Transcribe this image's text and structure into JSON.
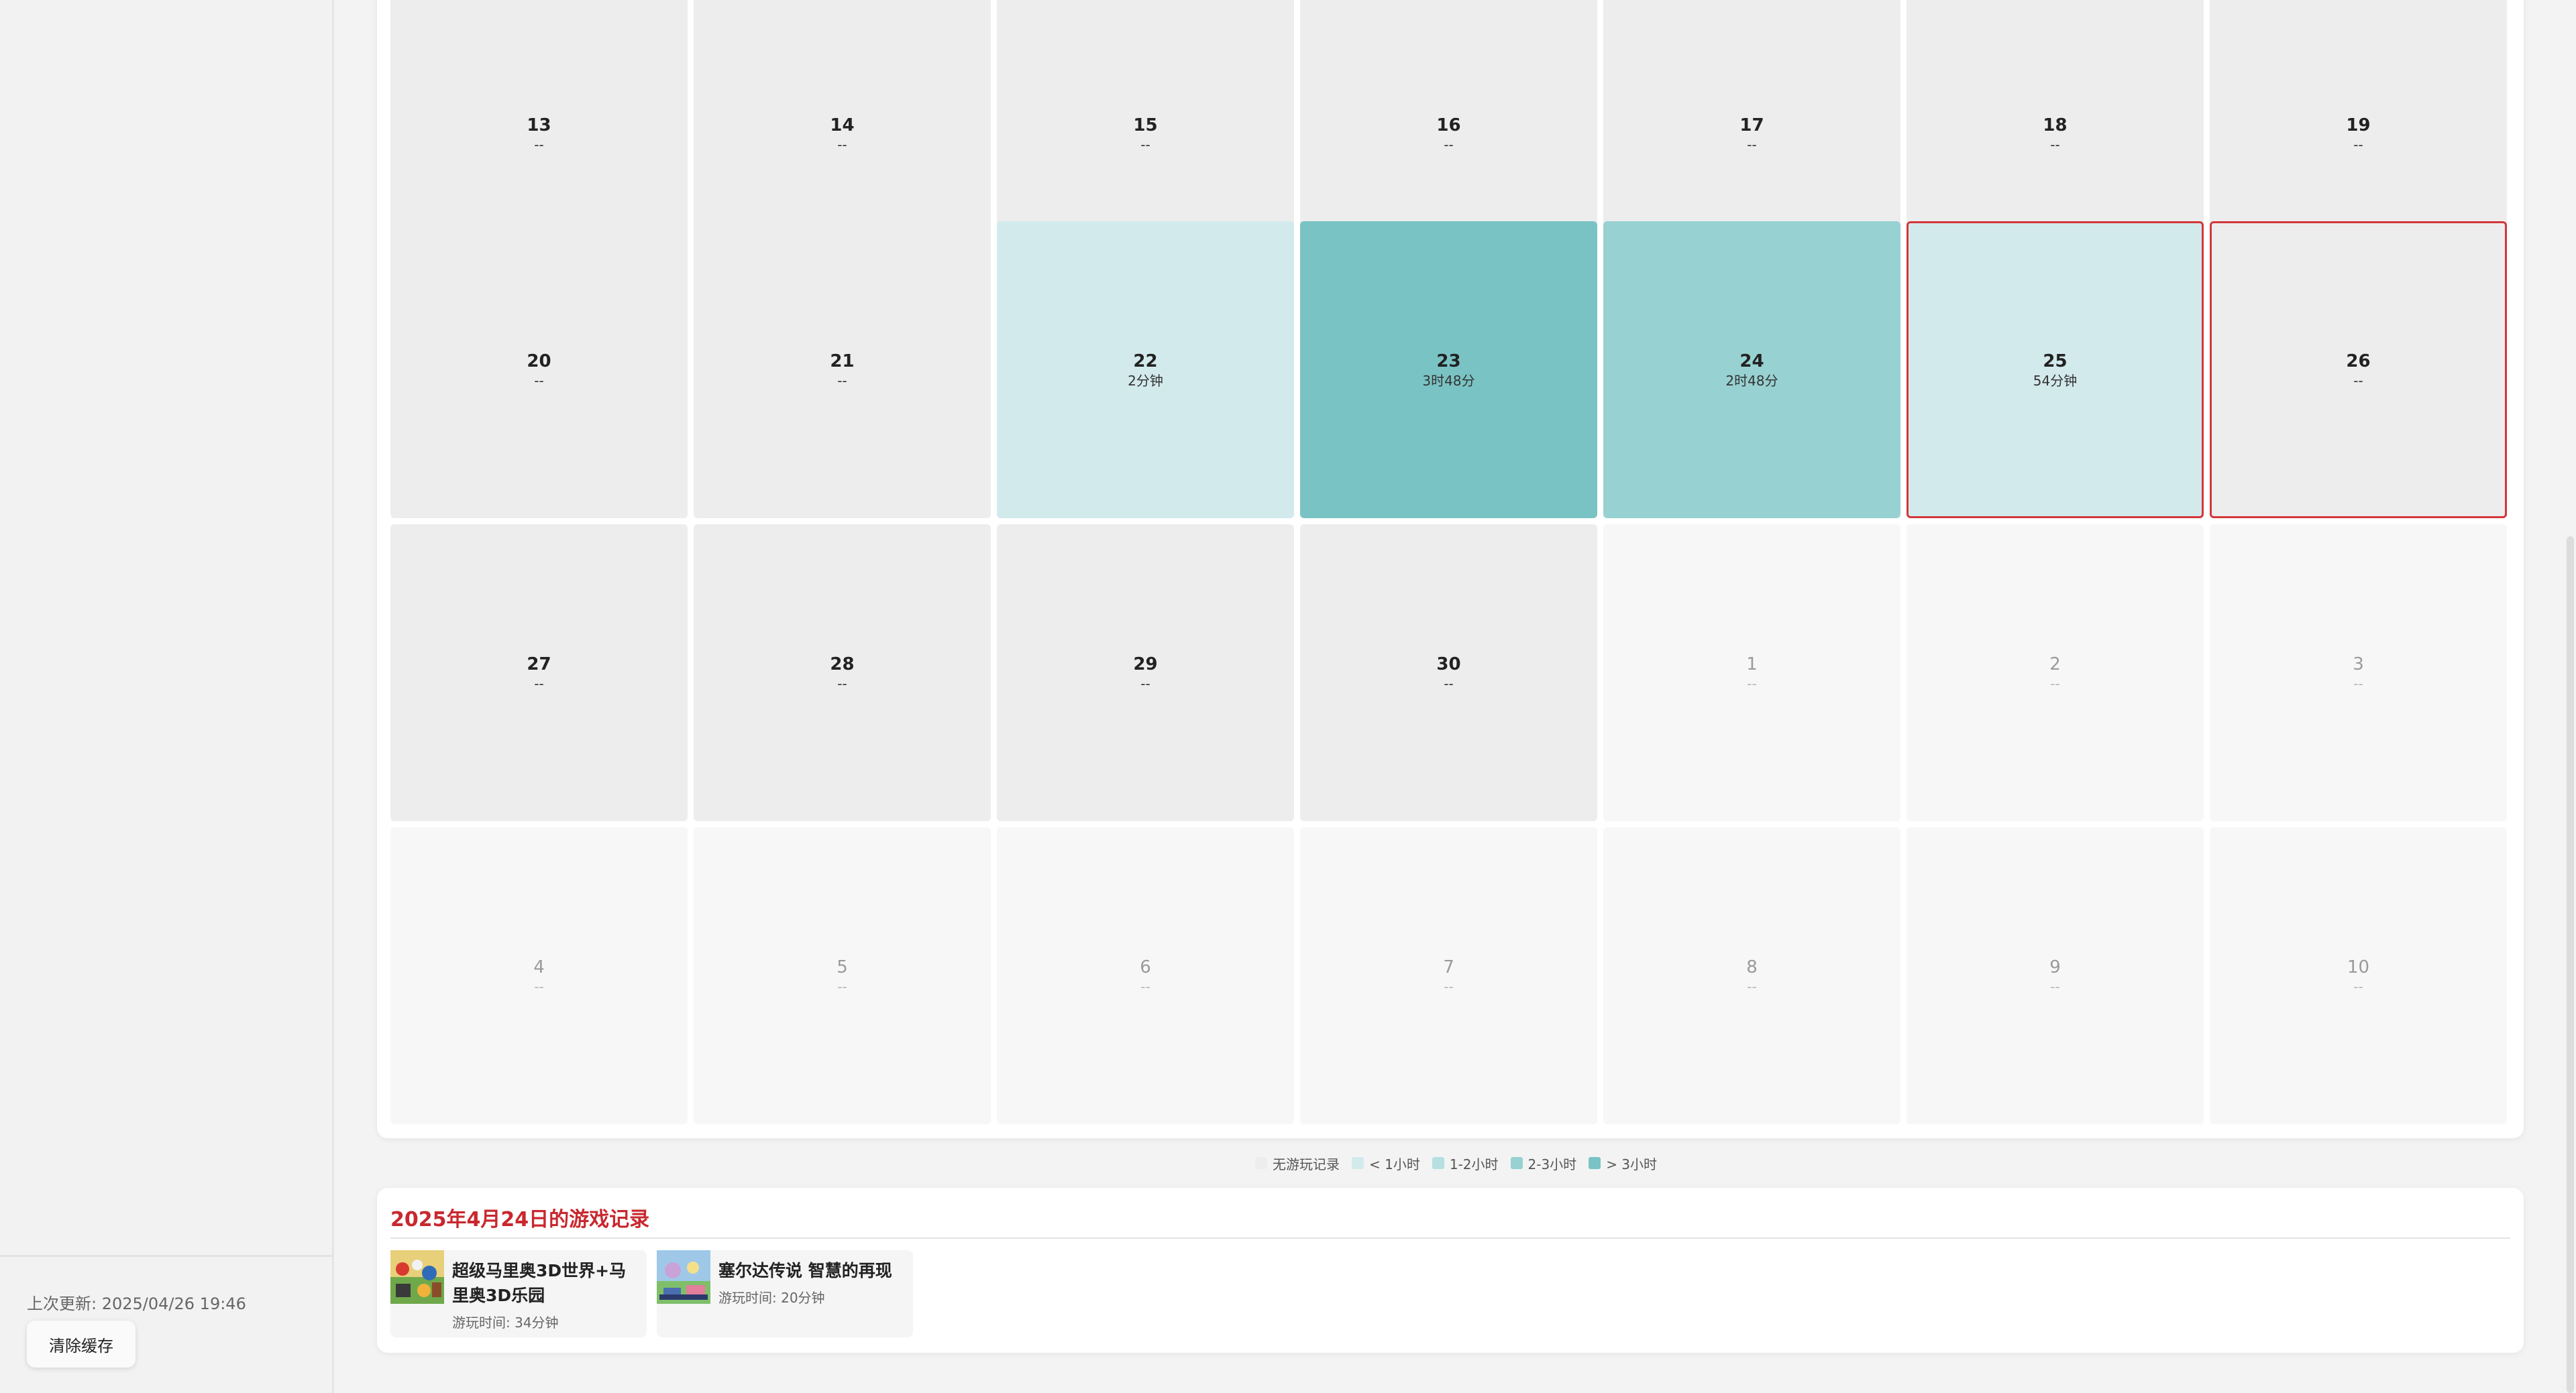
{
  "sidebar": {
    "last_updated": "上次更新: 2025/04/26 19:46",
    "clear_cache_label": "清除缓存"
  },
  "calendar": {
    "rows": [
      [
        {
          "day": "13",
          "time": "--",
          "level": "none",
          "current_month": true,
          "today": false
        },
        {
          "day": "14",
          "time": "--",
          "level": "none",
          "current_month": true,
          "today": false
        },
        {
          "day": "15",
          "time": "--",
          "level": "none",
          "current_month": true,
          "today": false
        },
        {
          "day": "16",
          "time": "--",
          "level": "none",
          "current_month": true,
          "today": false
        },
        {
          "day": "17",
          "time": "--",
          "level": "none",
          "current_month": true,
          "today": false
        },
        {
          "day": "18",
          "time": "--",
          "level": "none",
          "current_month": true,
          "today": false
        },
        {
          "day": "19",
          "time": "--",
          "level": "none",
          "current_month": true,
          "today": false
        }
      ],
      [
        {
          "day": "20",
          "time": "--",
          "level": "none",
          "current_month": true,
          "today": false
        },
        {
          "day": "21",
          "time": "--",
          "level": "none",
          "current_month": true,
          "today": false
        },
        {
          "day": "22",
          "time": "2分钟",
          "level": "lt1",
          "current_month": true,
          "today": false
        },
        {
          "day": "23",
          "time": "3时48分",
          "level": "gt3",
          "current_month": true,
          "today": false
        },
        {
          "day": "24",
          "time": "2时48分",
          "level": "2to3",
          "current_month": true,
          "today": false
        },
        {
          "day": "25",
          "time": "54分钟",
          "level": "lt1",
          "current_month": true,
          "today": true
        },
        {
          "day": "26",
          "time": "--",
          "level": "none",
          "current_month": true,
          "today": true
        }
      ],
      [
        {
          "day": "27",
          "time": "--",
          "level": "none",
          "current_month": true,
          "today": false
        },
        {
          "day": "28",
          "time": "--",
          "level": "none",
          "current_month": true,
          "today": false
        },
        {
          "day": "29",
          "time": "--",
          "level": "none",
          "current_month": true,
          "today": false
        },
        {
          "day": "30",
          "time": "--",
          "level": "none",
          "current_month": true,
          "today": false
        },
        {
          "day": "1",
          "time": "--",
          "level": "none",
          "current_month": false,
          "today": false
        },
        {
          "day": "2",
          "time": "--",
          "level": "none",
          "current_month": false,
          "today": false
        },
        {
          "day": "3",
          "time": "--",
          "level": "none",
          "current_month": false,
          "today": false
        }
      ],
      [
        {
          "day": "4",
          "time": "--",
          "level": "none",
          "current_month": false,
          "today": false
        },
        {
          "day": "5",
          "time": "--",
          "level": "none",
          "current_month": false,
          "today": false
        },
        {
          "day": "6",
          "time": "--",
          "level": "none",
          "current_month": false,
          "today": false
        },
        {
          "day": "7",
          "time": "--",
          "level": "none",
          "current_month": false,
          "today": false
        },
        {
          "day": "8",
          "time": "--",
          "level": "none",
          "current_month": false,
          "today": false
        },
        {
          "day": "9",
          "time": "--",
          "level": "none",
          "current_month": false,
          "today": false
        },
        {
          "day": "10",
          "time": "--",
          "level": "none",
          "current_month": false,
          "today": false
        }
      ]
    ]
  },
  "colors": {
    "none": "#ededed",
    "other_month": "#f7f7f7",
    "lt1": "#d3eaed",
    "1to2": "#b5dfe1",
    "2to3": "#98d1d2",
    "gt3": "#7ac3c4",
    "today_border": "#d3373a",
    "title_red": "#c8282e"
  },
  "legend": [
    {
      "label": "无游玩记录",
      "level": "none"
    },
    {
      "label": "< 1小时",
      "level": "lt1"
    },
    {
      "label": "1-2小时",
      "level": "1to2"
    },
    {
      "label": "2-3小时",
      "level": "2to3"
    },
    {
      "label": "> 3小时",
      "level": "gt3"
    }
  ],
  "records": {
    "title": "2025年4月24日的游戏记录",
    "games": [
      {
        "name": "超级马里奥3D世界+马里奥3D乐园",
        "time": "游玩时间: 34分钟",
        "icon": "mario-cover-icon"
      },
      {
        "name": "塞尔达传说 智慧的再现",
        "time": "游玩时间: 20分钟",
        "icon": "zelda-cover-icon"
      }
    ]
  }
}
